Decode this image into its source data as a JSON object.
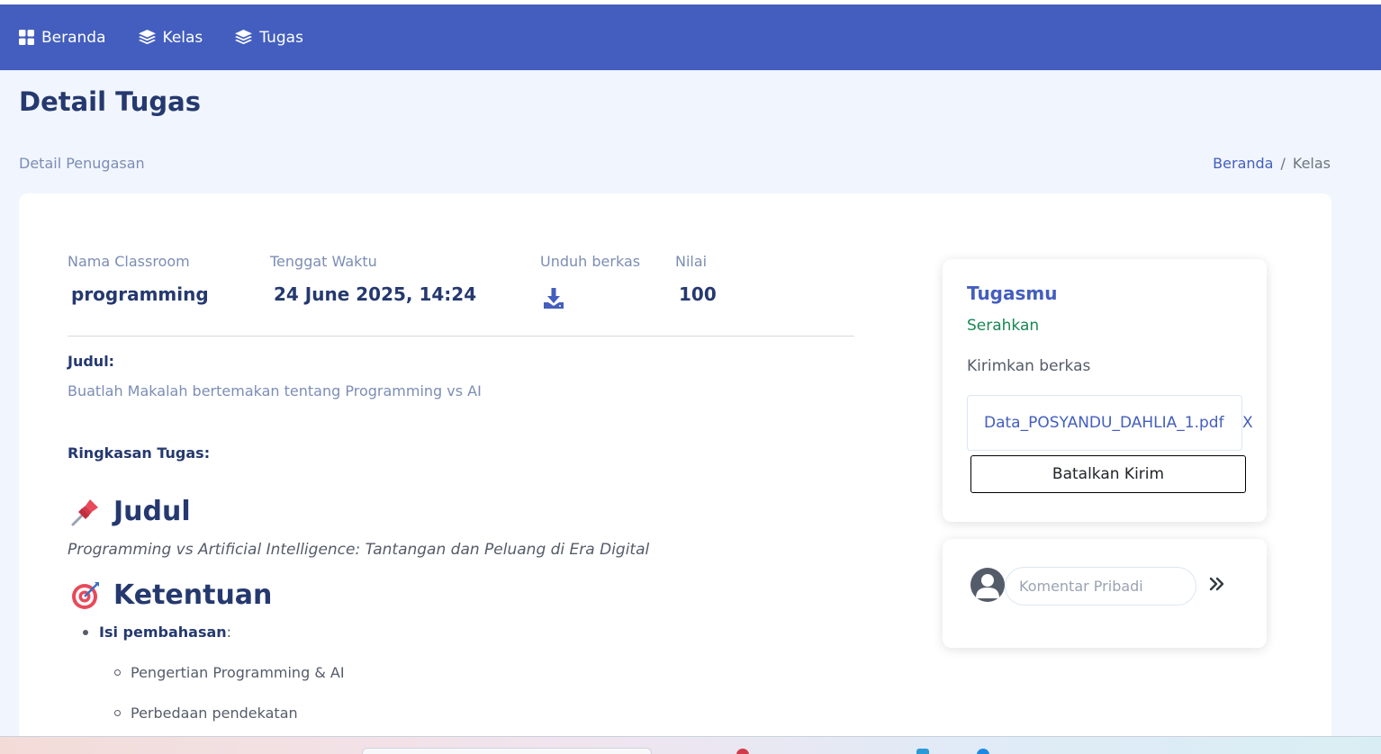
{
  "nav": {
    "items": [
      {
        "label": "Beranda",
        "icon": "grid-icon"
      },
      {
        "label": "Kelas",
        "icon": "layers-icon"
      },
      {
        "label": "Tugas",
        "icon": "layers-icon"
      }
    ]
  },
  "page": {
    "title": "Detail Tugas",
    "subtitle": "Detail Penugasan",
    "breadcrumb": {
      "home": "Beranda",
      "separator": "/",
      "current": "Kelas"
    }
  },
  "task": {
    "classroom_label": "Nama Classroom",
    "classroom_value": "programming",
    "deadline_label": "Tenggat Waktu",
    "deadline_value": "24 June 2025, 14:24",
    "download_label": "Unduh berkas",
    "score_label": "Nilai",
    "score_value": "100",
    "judul_label": "Judul:",
    "judul_value": "Buatlah Makalah bertemakan tentang Programming vs AI",
    "summary_label": "Ringkasan Tugas:",
    "summary": {
      "heading1": "Judul",
      "heading1_icon": "pushpin-icon",
      "subtitle_italic": "Programming vs Artificial Intelligence: Tantangan dan Peluang di Era Digital",
      "heading2": "Ketentuan",
      "heading2_icon": "target-icon",
      "bullet_bold": "Isi pembahasan",
      "bullet_suffix": ":",
      "subitems": [
        "Pengertian Programming & AI",
        "Perbedaan pendekatan"
      ]
    }
  },
  "submission": {
    "title": "Tugasmu",
    "status": "Serahkan",
    "send_label": "Kirimkan berkas",
    "file_name": "Data_POSYANDU_DAHLIA_1.pdf",
    "remove_label": "X",
    "cancel_button": "Batalkan Kirim"
  },
  "comment": {
    "placeholder": "Komentar Pribadi"
  },
  "colors": {
    "primary": "#435ebe",
    "heading": "#25396f",
    "success": "#198754",
    "background": "#f1f5fd"
  }
}
